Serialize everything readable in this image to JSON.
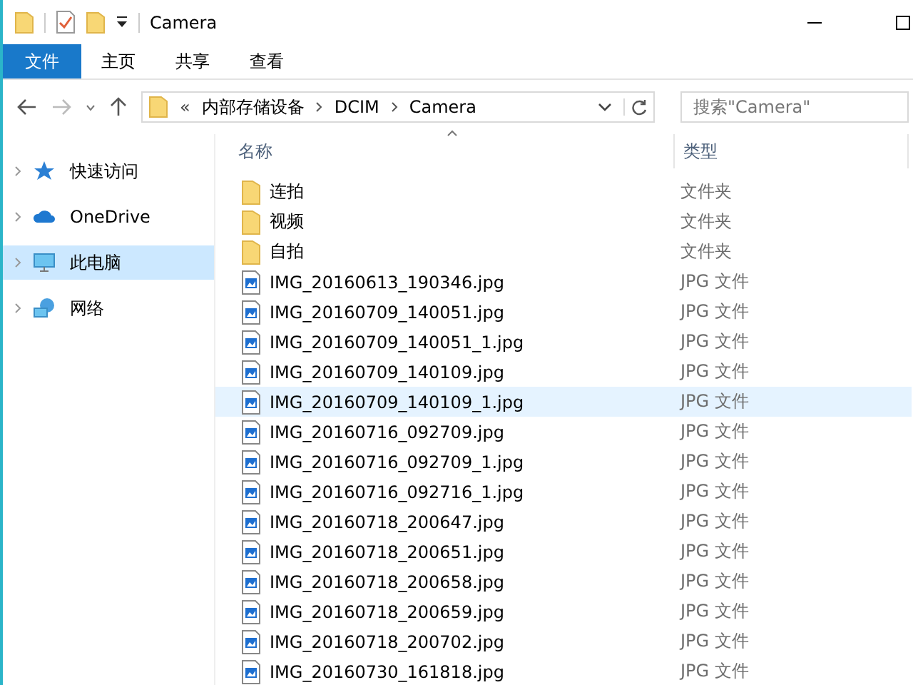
{
  "window": {
    "title": "Camera"
  },
  "ribbon_tabs": [
    {
      "label": "文件",
      "kind": "file"
    },
    {
      "label": "主页",
      "kind": "tab"
    },
    {
      "label": "共享",
      "kind": "tab"
    },
    {
      "label": "查看",
      "kind": "tab"
    }
  ],
  "address_bar": {
    "overflow": "«",
    "path": [
      "内部存储设备",
      "DCIM",
      "Camera"
    ]
  },
  "search": {
    "placeholder": "搜索\"Camera\""
  },
  "sidebar": {
    "items": [
      {
        "label": "快速访问",
        "kind": "star",
        "selected": false
      },
      {
        "label": "OneDrive",
        "kind": "cloud",
        "selected": false
      },
      {
        "label": "此电脑",
        "kind": "pc",
        "selected": true
      },
      {
        "label": "网络",
        "kind": "network",
        "selected": false
      }
    ]
  },
  "table": {
    "columns": [
      "名称",
      "类型"
    ],
    "rows": [
      {
        "name": "连拍",
        "type": "文件夹",
        "kind": "folder",
        "hovered": false
      },
      {
        "name": "视频",
        "type": "文件夹",
        "kind": "folder",
        "hovered": false
      },
      {
        "name": "自拍",
        "type": "文件夹",
        "kind": "folder",
        "hovered": false
      },
      {
        "name": "IMG_20160613_190346.jpg",
        "type": "JPG 文件",
        "kind": "image",
        "hovered": false
      },
      {
        "name": "IMG_20160709_140051.jpg",
        "type": "JPG 文件",
        "kind": "image",
        "hovered": false
      },
      {
        "name": "IMG_20160709_140051_1.jpg",
        "type": "JPG 文件",
        "kind": "image",
        "hovered": false
      },
      {
        "name": "IMG_20160709_140109.jpg",
        "type": "JPG 文件",
        "kind": "image",
        "hovered": false
      },
      {
        "name": "IMG_20160709_140109_1.jpg",
        "type": "JPG 文件",
        "kind": "image",
        "hovered": true
      },
      {
        "name": "IMG_20160716_092709.jpg",
        "type": "JPG 文件",
        "kind": "image",
        "hovered": false
      },
      {
        "name": "IMG_20160716_092709_1.jpg",
        "type": "JPG 文件",
        "kind": "image",
        "hovered": false
      },
      {
        "name": "IMG_20160716_092716_1.jpg",
        "type": "JPG 文件",
        "kind": "image",
        "hovered": false
      },
      {
        "name": "IMG_20160718_200647.jpg",
        "type": "JPG 文件",
        "kind": "image",
        "hovered": false
      },
      {
        "name": "IMG_20160718_200651.jpg",
        "type": "JPG 文件",
        "kind": "image",
        "hovered": false
      },
      {
        "name": "IMG_20160718_200658.jpg",
        "type": "JPG 文件",
        "kind": "image",
        "hovered": false
      },
      {
        "name": "IMG_20160718_200659.jpg",
        "type": "JPG 文件",
        "kind": "image",
        "hovered": false
      },
      {
        "name": "IMG_20160718_200702.jpg",
        "type": "JPG 文件",
        "kind": "image",
        "hovered": false
      },
      {
        "name": "IMG_20160730_161818.jpg",
        "type": "JPG 文件",
        "kind": "image",
        "hovered": false
      }
    ]
  }
}
